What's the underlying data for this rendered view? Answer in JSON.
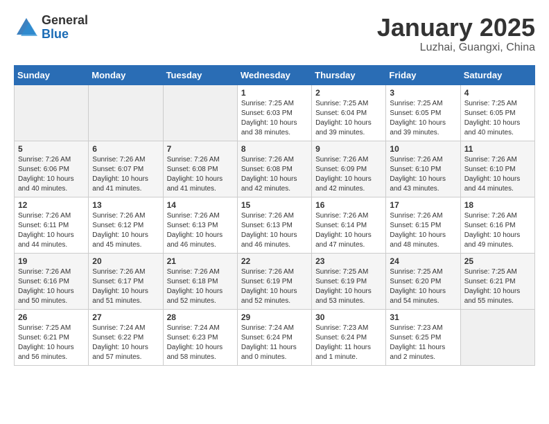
{
  "logo": {
    "general": "General",
    "blue": "Blue"
  },
  "title": "January 2025",
  "subtitle": "Luzhai, Guangxi, China",
  "header_days": [
    "Sunday",
    "Monday",
    "Tuesday",
    "Wednesday",
    "Thursday",
    "Friday",
    "Saturday"
  ],
  "weeks": [
    [
      {
        "date": "",
        "info": ""
      },
      {
        "date": "",
        "info": ""
      },
      {
        "date": "",
        "info": ""
      },
      {
        "date": "1",
        "info": "Sunrise: 7:25 AM\nSunset: 6:03 PM\nDaylight: 10 hours\nand 38 minutes."
      },
      {
        "date": "2",
        "info": "Sunrise: 7:25 AM\nSunset: 6:04 PM\nDaylight: 10 hours\nand 39 minutes."
      },
      {
        "date": "3",
        "info": "Sunrise: 7:25 AM\nSunset: 6:05 PM\nDaylight: 10 hours\nand 39 minutes."
      },
      {
        "date": "4",
        "info": "Sunrise: 7:25 AM\nSunset: 6:05 PM\nDaylight: 10 hours\nand 40 minutes."
      }
    ],
    [
      {
        "date": "5",
        "info": "Sunrise: 7:26 AM\nSunset: 6:06 PM\nDaylight: 10 hours\nand 40 minutes."
      },
      {
        "date": "6",
        "info": "Sunrise: 7:26 AM\nSunset: 6:07 PM\nDaylight: 10 hours\nand 41 minutes."
      },
      {
        "date": "7",
        "info": "Sunrise: 7:26 AM\nSunset: 6:08 PM\nDaylight: 10 hours\nand 41 minutes."
      },
      {
        "date": "8",
        "info": "Sunrise: 7:26 AM\nSunset: 6:08 PM\nDaylight: 10 hours\nand 42 minutes."
      },
      {
        "date": "9",
        "info": "Sunrise: 7:26 AM\nSunset: 6:09 PM\nDaylight: 10 hours\nand 42 minutes."
      },
      {
        "date": "10",
        "info": "Sunrise: 7:26 AM\nSunset: 6:10 PM\nDaylight: 10 hours\nand 43 minutes."
      },
      {
        "date": "11",
        "info": "Sunrise: 7:26 AM\nSunset: 6:10 PM\nDaylight: 10 hours\nand 44 minutes."
      }
    ],
    [
      {
        "date": "12",
        "info": "Sunrise: 7:26 AM\nSunset: 6:11 PM\nDaylight: 10 hours\nand 44 minutes."
      },
      {
        "date": "13",
        "info": "Sunrise: 7:26 AM\nSunset: 6:12 PM\nDaylight: 10 hours\nand 45 minutes."
      },
      {
        "date": "14",
        "info": "Sunrise: 7:26 AM\nSunset: 6:13 PM\nDaylight: 10 hours\nand 46 minutes."
      },
      {
        "date": "15",
        "info": "Sunrise: 7:26 AM\nSunset: 6:13 PM\nDaylight: 10 hours\nand 46 minutes."
      },
      {
        "date": "16",
        "info": "Sunrise: 7:26 AM\nSunset: 6:14 PM\nDaylight: 10 hours\nand 47 minutes."
      },
      {
        "date": "17",
        "info": "Sunrise: 7:26 AM\nSunset: 6:15 PM\nDaylight: 10 hours\nand 48 minutes."
      },
      {
        "date": "18",
        "info": "Sunrise: 7:26 AM\nSunset: 6:16 PM\nDaylight: 10 hours\nand 49 minutes."
      }
    ],
    [
      {
        "date": "19",
        "info": "Sunrise: 7:26 AM\nSunset: 6:16 PM\nDaylight: 10 hours\nand 50 minutes."
      },
      {
        "date": "20",
        "info": "Sunrise: 7:26 AM\nSunset: 6:17 PM\nDaylight: 10 hours\nand 51 minutes."
      },
      {
        "date": "21",
        "info": "Sunrise: 7:26 AM\nSunset: 6:18 PM\nDaylight: 10 hours\nand 52 minutes."
      },
      {
        "date": "22",
        "info": "Sunrise: 7:26 AM\nSunset: 6:19 PM\nDaylight: 10 hours\nand 52 minutes."
      },
      {
        "date": "23",
        "info": "Sunrise: 7:25 AM\nSunset: 6:19 PM\nDaylight: 10 hours\nand 53 minutes."
      },
      {
        "date": "24",
        "info": "Sunrise: 7:25 AM\nSunset: 6:20 PM\nDaylight: 10 hours\nand 54 minutes."
      },
      {
        "date": "25",
        "info": "Sunrise: 7:25 AM\nSunset: 6:21 PM\nDaylight: 10 hours\nand 55 minutes."
      }
    ],
    [
      {
        "date": "26",
        "info": "Sunrise: 7:25 AM\nSunset: 6:21 PM\nDaylight: 10 hours\nand 56 minutes."
      },
      {
        "date": "27",
        "info": "Sunrise: 7:24 AM\nSunset: 6:22 PM\nDaylight: 10 hours\nand 57 minutes."
      },
      {
        "date": "28",
        "info": "Sunrise: 7:24 AM\nSunset: 6:23 PM\nDaylight: 10 hours\nand 58 minutes."
      },
      {
        "date": "29",
        "info": "Sunrise: 7:24 AM\nSunset: 6:24 PM\nDaylight: 11 hours\nand 0 minutes."
      },
      {
        "date": "30",
        "info": "Sunrise: 7:23 AM\nSunset: 6:24 PM\nDaylight: 11 hours\nand 1 minute."
      },
      {
        "date": "31",
        "info": "Sunrise: 7:23 AM\nSunset: 6:25 PM\nDaylight: 11 hours\nand 2 minutes."
      },
      {
        "date": "",
        "info": ""
      }
    ]
  ]
}
